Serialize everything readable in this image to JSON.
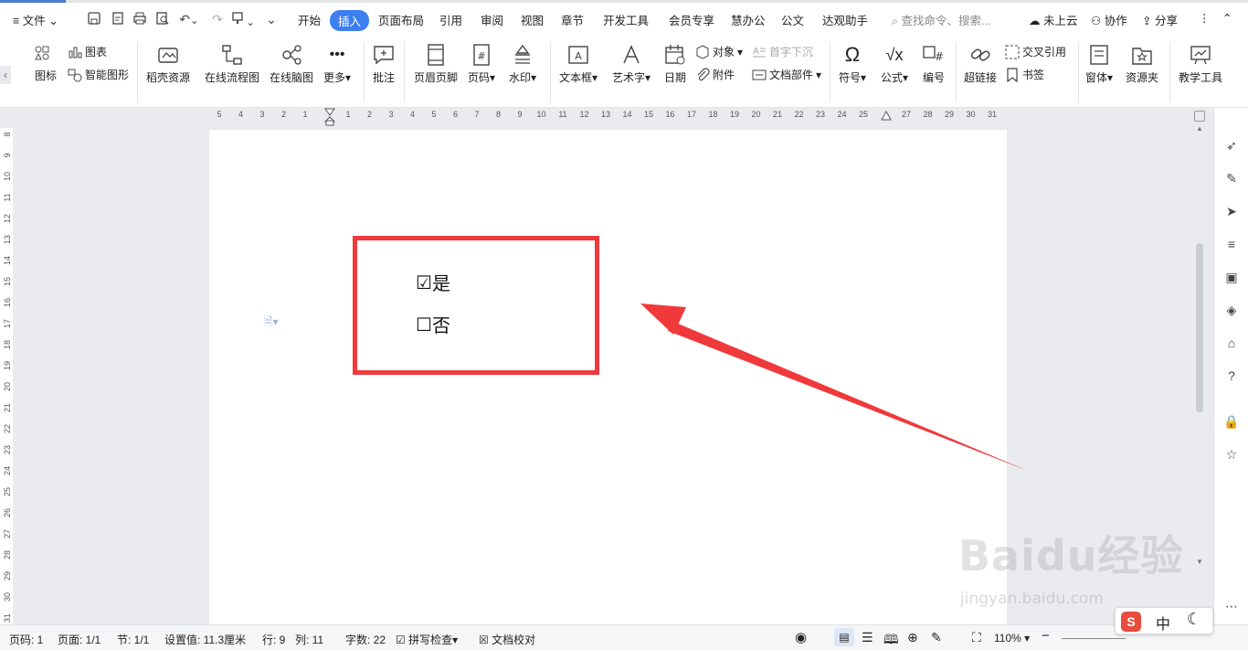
{
  "menu": {
    "file": "文件",
    "tabs": [
      "开始",
      "插入",
      "页面布局",
      "引用",
      "审阅",
      "视图",
      "章节",
      "开发工具",
      "会员专享",
      "慧办公",
      "公文",
      "达观助手"
    ],
    "search_placeholder": "查找命令、搜索...",
    "cloud": "未上云",
    "collab": "协作",
    "share": "分享"
  },
  "ribbon": {
    "icon_label": "图标",
    "chart": "图表",
    "smart_shape": "智能图形",
    "docer": "稻壳资源",
    "flowchart": "在线流程图",
    "mindmap": "在线脑图",
    "more": "更多",
    "comment": "批注",
    "header_footer": "页眉页脚",
    "page_num": "页码",
    "watermark": "水印",
    "textbox": "文本框",
    "wordart": "艺术字",
    "date": "日期",
    "object": "对象",
    "dropcap": "首字下沉",
    "attachment": "附件",
    "doc_parts": "文档部件",
    "symbol": "符号",
    "formula": "公式",
    "numbering": "编号",
    "hyperlink": "超链接",
    "crossref": "交叉引用",
    "bookmark": "书签",
    "window": "窗体",
    "resource": "资源夹",
    "teaching": "教学工具"
  },
  "ruler": {
    "h": [
      "5",
      "4",
      "3",
      "2",
      "1",
      "",
      "1",
      "2",
      "3",
      "4",
      "5",
      "6",
      "7",
      "8",
      "9",
      "10",
      "11",
      "12",
      "13",
      "14",
      "15",
      "16",
      "17",
      "18",
      "19",
      "20",
      "21",
      "22",
      "23",
      "24",
      "25",
      "",
      "27",
      "28",
      "29",
      "30",
      "31"
    ],
    "v": [
      "8",
      "9",
      "10",
      "11",
      "12",
      "13",
      "14",
      "15",
      "16",
      "17",
      "18",
      "19",
      "20",
      "21",
      "22",
      "23",
      "24",
      "25",
      "26",
      "27",
      "28",
      "29",
      "30",
      "31"
    ]
  },
  "document": {
    "options": [
      {
        "mark": "☑",
        "text": "是"
      },
      {
        "mark": "☐",
        "text": "否"
      }
    ]
  },
  "status": {
    "page_code": "页码: 1",
    "pages": "页面: 1/1",
    "section": "节: 1/1",
    "setting": "设置值: 11.3厘米",
    "row": "行: 9",
    "col": "列: 11",
    "words": "字数: 22",
    "spell": "拼写检查",
    "proof": "文档校对",
    "zoom": "110%"
  },
  "watermark": {
    "brand": "Baidu经验",
    "url": "jingyan.baidu.com"
  },
  "ime": {
    "lang": "中"
  },
  "colors": {
    "accent": "#3d7ff1",
    "annotation": "#f0393b"
  }
}
